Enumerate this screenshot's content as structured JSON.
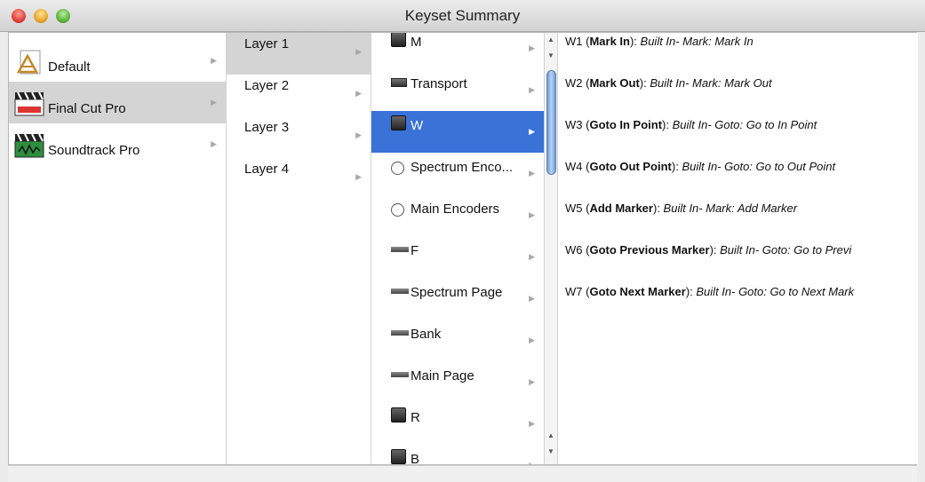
{
  "window": {
    "title": "Keyset Summary"
  },
  "applications": {
    "items": [
      {
        "label": "Default",
        "icon": "default-app-icon",
        "selected": false
      },
      {
        "label": "Final Cut Pro",
        "icon": "clapperboard-icon",
        "selected": true
      },
      {
        "label": "Soundtrack Pro",
        "icon": "clapperboard-green-icon",
        "selected": false
      }
    ]
  },
  "layers": {
    "items": [
      {
        "label": "Layer 1",
        "selected": true
      },
      {
        "label": "Layer 2",
        "selected": false
      },
      {
        "label": "Layer 3",
        "selected": false
      },
      {
        "label": "Layer 4",
        "selected": false
      }
    ]
  },
  "keysets": {
    "items": [
      {
        "label": "M",
        "icon": "square-key-icon",
        "selected": false
      },
      {
        "label": "Transport",
        "icon": "transport-key-icon",
        "selected": false
      },
      {
        "label": "W",
        "icon": "square-key-icon",
        "selected": true
      },
      {
        "label": "Spectrum Enco...",
        "icon": "knob-icon",
        "selected": false
      },
      {
        "label": "Main Encoders",
        "icon": "knob-icon",
        "selected": false
      },
      {
        "label": "F",
        "icon": "key-bar-icon",
        "selected": false
      },
      {
        "label": "Spectrum Page",
        "icon": "key-bar-icon",
        "selected": false
      },
      {
        "label": "Bank",
        "icon": "key-bar-icon",
        "selected": false
      },
      {
        "label": "Main Page",
        "icon": "key-bar-icon",
        "selected": false
      },
      {
        "label": "R",
        "icon": "square-key-icon",
        "selected": false
      },
      {
        "label": "B",
        "icon": "square-key-icon",
        "selected": false
      }
    ]
  },
  "bindings": {
    "items": [
      {
        "key": "W1",
        "name": "Mark In",
        "action": "Built In- Mark: Mark In"
      },
      {
        "key": "W2",
        "name": "Mark Out",
        "action": "Built In- Mark: Mark Out"
      },
      {
        "key": "W3",
        "name": "Goto In Point",
        "action": "Built In- Goto: Go to In Point"
      },
      {
        "key": "W4",
        "name": "Goto Out Point",
        "action": "Built In- Goto: Go to Out Point"
      },
      {
        "key": "W5",
        "name": "Add Marker",
        "action": "Built In- Mark: Add Marker"
      },
      {
        "key": "W6",
        "name": "Goto Previous Marker",
        "action": "Built In- Goto: Go to Previ"
      },
      {
        "key": "W7",
        "name": "Goto Next Marker",
        "action": "Built In- Goto: Go to Next Mark"
      }
    ]
  }
}
